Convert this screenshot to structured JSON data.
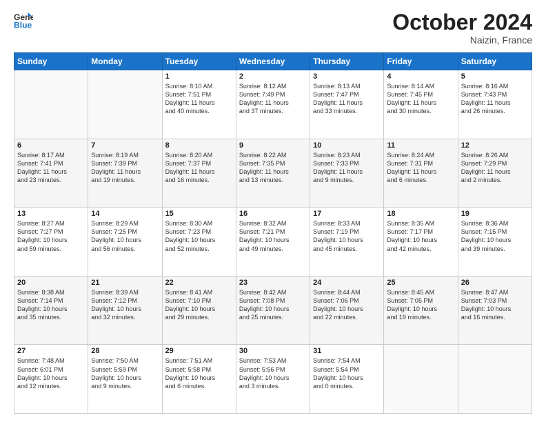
{
  "header": {
    "logo_general": "General",
    "logo_blue": "Blue",
    "month": "October 2024",
    "location": "Naizin, France"
  },
  "days_of_week": [
    "Sunday",
    "Monday",
    "Tuesday",
    "Wednesday",
    "Thursday",
    "Friday",
    "Saturday"
  ],
  "weeks": [
    {
      "shaded": false,
      "days": [
        {
          "num": "",
          "info": ""
        },
        {
          "num": "",
          "info": ""
        },
        {
          "num": "1",
          "info": "Sunrise: 8:10 AM\nSunset: 7:51 PM\nDaylight: 11 hours\nand 40 minutes."
        },
        {
          "num": "2",
          "info": "Sunrise: 8:12 AM\nSunset: 7:49 PM\nDaylight: 11 hours\nand 37 minutes."
        },
        {
          "num": "3",
          "info": "Sunrise: 8:13 AM\nSunset: 7:47 PM\nDaylight: 11 hours\nand 33 minutes."
        },
        {
          "num": "4",
          "info": "Sunrise: 8:14 AM\nSunset: 7:45 PM\nDaylight: 11 hours\nand 30 minutes."
        },
        {
          "num": "5",
          "info": "Sunrise: 8:16 AM\nSunset: 7:43 PM\nDaylight: 11 hours\nand 26 minutes."
        }
      ]
    },
    {
      "shaded": true,
      "days": [
        {
          "num": "6",
          "info": "Sunrise: 8:17 AM\nSunset: 7:41 PM\nDaylight: 11 hours\nand 23 minutes."
        },
        {
          "num": "7",
          "info": "Sunrise: 8:19 AM\nSunset: 7:39 PM\nDaylight: 11 hours\nand 19 minutes."
        },
        {
          "num": "8",
          "info": "Sunrise: 8:20 AM\nSunset: 7:37 PM\nDaylight: 11 hours\nand 16 minutes."
        },
        {
          "num": "9",
          "info": "Sunrise: 8:22 AM\nSunset: 7:35 PM\nDaylight: 11 hours\nand 13 minutes."
        },
        {
          "num": "10",
          "info": "Sunrise: 8:23 AM\nSunset: 7:33 PM\nDaylight: 11 hours\nand 9 minutes."
        },
        {
          "num": "11",
          "info": "Sunrise: 8:24 AM\nSunset: 7:31 PM\nDaylight: 11 hours\nand 6 minutes."
        },
        {
          "num": "12",
          "info": "Sunrise: 8:26 AM\nSunset: 7:29 PM\nDaylight: 11 hours\nand 2 minutes."
        }
      ]
    },
    {
      "shaded": false,
      "days": [
        {
          "num": "13",
          "info": "Sunrise: 8:27 AM\nSunset: 7:27 PM\nDaylight: 10 hours\nand 59 minutes."
        },
        {
          "num": "14",
          "info": "Sunrise: 8:29 AM\nSunset: 7:25 PM\nDaylight: 10 hours\nand 56 minutes."
        },
        {
          "num": "15",
          "info": "Sunrise: 8:30 AM\nSunset: 7:23 PM\nDaylight: 10 hours\nand 52 minutes."
        },
        {
          "num": "16",
          "info": "Sunrise: 8:32 AM\nSunset: 7:21 PM\nDaylight: 10 hours\nand 49 minutes."
        },
        {
          "num": "17",
          "info": "Sunrise: 8:33 AM\nSunset: 7:19 PM\nDaylight: 10 hours\nand 45 minutes."
        },
        {
          "num": "18",
          "info": "Sunrise: 8:35 AM\nSunset: 7:17 PM\nDaylight: 10 hours\nand 42 minutes."
        },
        {
          "num": "19",
          "info": "Sunrise: 8:36 AM\nSunset: 7:15 PM\nDaylight: 10 hours\nand 39 minutes."
        }
      ]
    },
    {
      "shaded": true,
      "days": [
        {
          "num": "20",
          "info": "Sunrise: 8:38 AM\nSunset: 7:14 PM\nDaylight: 10 hours\nand 35 minutes."
        },
        {
          "num": "21",
          "info": "Sunrise: 8:39 AM\nSunset: 7:12 PM\nDaylight: 10 hours\nand 32 minutes."
        },
        {
          "num": "22",
          "info": "Sunrise: 8:41 AM\nSunset: 7:10 PM\nDaylight: 10 hours\nand 29 minutes."
        },
        {
          "num": "23",
          "info": "Sunrise: 8:42 AM\nSunset: 7:08 PM\nDaylight: 10 hours\nand 25 minutes."
        },
        {
          "num": "24",
          "info": "Sunrise: 8:44 AM\nSunset: 7:06 PM\nDaylight: 10 hours\nand 22 minutes."
        },
        {
          "num": "25",
          "info": "Sunrise: 8:45 AM\nSunset: 7:05 PM\nDaylight: 10 hours\nand 19 minutes."
        },
        {
          "num": "26",
          "info": "Sunrise: 8:47 AM\nSunset: 7:03 PM\nDaylight: 10 hours\nand 16 minutes."
        }
      ]
    },
    {
      "shaded": false,
      "days": [
        {
          "num": "27",
          "info": "Sunrise: 7:48 AM\nSunset: 6:01 PM\nDaylight: 10 hours\nand 12 minutes."
        },
        {
          "num": "28",
          "info": "Sunrise: 7:50 AM\nSunset: 5:59 PM\nDaylight: 10 hours\nand 9 minutes."
        },
        {
          "num": "29",
          "info": "Sunrise: 7:51 AM\nSunset: 5:58 PM\nDaylight: 10 hours\nand 6 minutes."
        },
        {
          "num": "30",
          "info": "Sunrise: 7:53 AM\nSunset: 5:56 PM\nDaylight: 10 hours\nand 3 minutes."
        },
        {
          "num": "31",
          "info": "Sunrise: 7:54 AM\nSunset: 5:54 PM\nDaylight: 10 hours\nand 0 minutes."
        },
        {
          "num": "",
          "info": ""
        },
        {
          "num": "",
          "info": ""
        }
      ]
    }
  ]
}
